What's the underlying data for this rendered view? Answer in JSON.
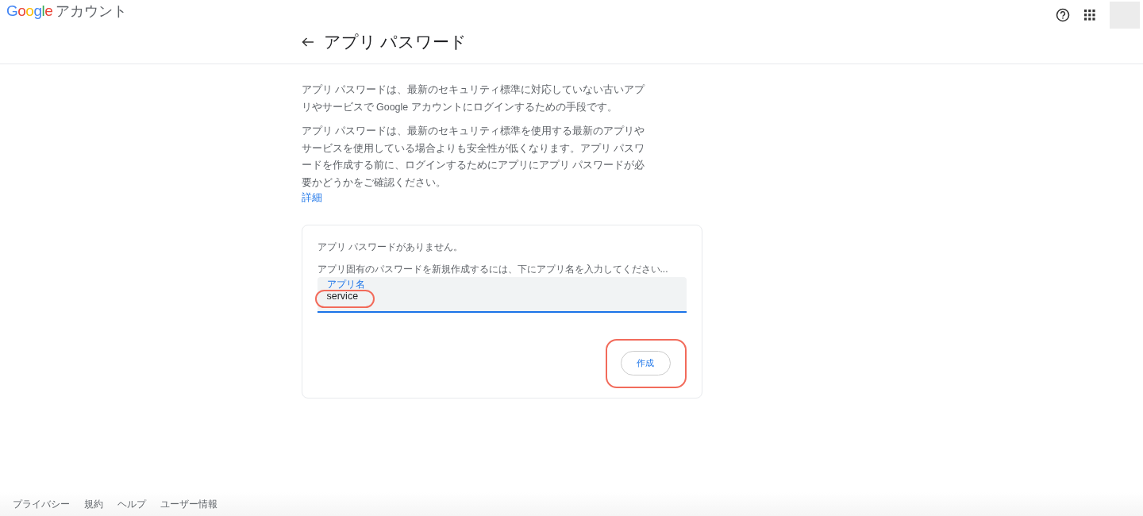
{
  "header": {
    "logo": "Google",
    "product": "アカウント"
  },
  "page": {
    "title": "アプリ パスワード"
  },
  "intro": [
    "アプリ パスワードは、最新のセキュリティ標準に対応していない古いアプリやサービスで Google アカウントにログインするための手段です。",
    "アプリ パスワードは、最新のセキュリティ標準を使用する最新のアプリやサービスを使用している場合よりも安全性が低くなります。アプリ パスワードを作成する前に、ログインするためにアプリにアプリ パスワードが必要かどうかをご確認ください。"
  ],
  "learn_more": "詳細",
  "card": {
    "empty_message": "アプリ パスワードがありません。",
    "instruction": "アプリ固有のパスワードを新規作成するには、下にアプリ名を入力してください...",
    "field": {
      "label": "アプリ名",
      "value": "service",
      "focused": true,
      "annotated": true
    },
    "button": {
      "label": "作成",
      "annotated": true
    }
  },
  "footer": [
    "プライバシー",
    "規約",
    "ヘルプ",
    "ユーザー情報"
  ]
}
